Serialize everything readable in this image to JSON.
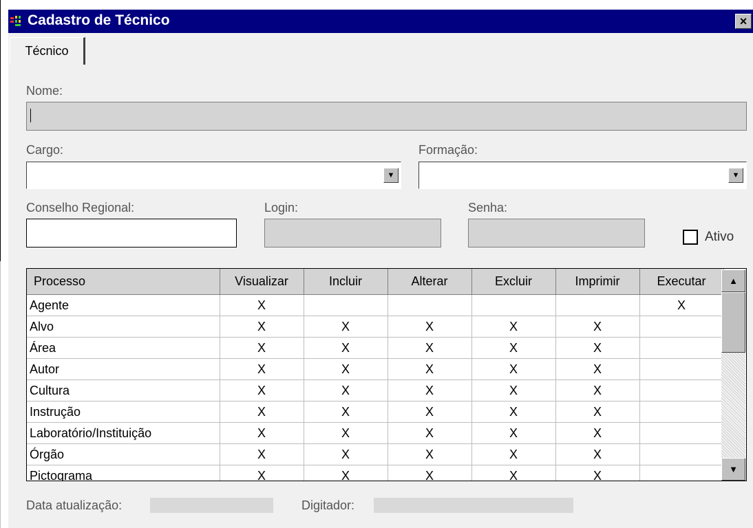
{
  "window": {
    "title": "Cadastro de Técnico",
    "close_label": "×"
  },
  "tabs": [
    {
      "label": "Técnico"
    }
  ],
  "form": {
    "nome_label": "Nome:",
    "nome_value": "",
    "cargo_label": "Cargo:",
    "cargo_value": "",
    "formacao_label": "Formação:",
    "formacao_value": "",
    "conselho_label": "Conselho Regional:",
    "conselho_value": "",
    "login_label": "Login:",
    "login_value": "",
    "senha_label": "Senha:",
    "senha_value": "",
    "ativo_label": "Ativo",
    "ativo_checked": false
  },
  "grid": {
    "columns": [
      "Processo",
      "Visualizar",
      "Incluir",
      "Alterar",
      "Excluir",
      "Imprimir",
      "Executar"
    ],
    "rows": [
      [
        "Agente",
        "X",
        "",
        "",
        "",
        "",
        "X"
      ],
      [
        "Alvo",
        "X",
        "X",
        "X",
        "X",
        "X",
        ""
      ],
      [
        "Área",
        "X",
        "X",
        "X",
        "X",
        "X",
        ""
      ],
      [
        "Autor",
        "X",
        "X",
        "X",
        "X",
        "X",
        ""
      ],
      [
        "Cultura",
        "X",
        "X",
        "X",
        "X",
        "X",
        ""
      ],
      [
        "Instrução",
        "X",
        "X",
        "X",
        "X",
        "X",
        ""
      ],
      [
        "Laboratório/Instituição",
        "X",
        "X",
        "X",
        "X",
        "X",
        ""
      ],
      [
        "Órgão",
        "X",
        "X",
        "X",
        "X",
        "X",
        ""
      ],
      [
        "Pictograma",
        "X",
        "X",
        "X",
        "X",
        "X",
        ""
      ]
    ]
  },
  "footer": {
    "data_label": "Data atualização:",
    "data_value": "",
    "digitador_label": "Digitador:",
    "digitador_value": ""
  },
  "icons": {
    "app": "app-icon",
    "dropdown": "chevron-down-icon",
    "scroll_up": "arrow-up-icon",
    "scroll_down": "arrow-down-icon"
  }
}
